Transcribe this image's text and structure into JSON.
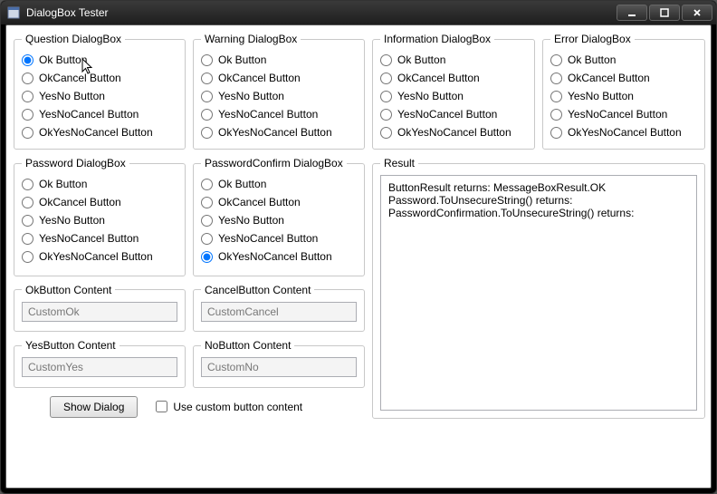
{
  "window": {
    "title": "DialogBox Tester"
  },
  "radio_options": [
    "Ok Button",
    "OkCancel Button",
    "YesNo Button",
    "YesNoCancel Button",
    "OkYesNoCancel Button"
  ],
  "groups": {
    "question": {
      "legend": "Question DialogBox",
      "selected": 0
    },
    "warning": {
      "legend": "Warning DialogBox",
      "selected": -1
    },
    "info": {
      "legend": "Information DialogBox",
      "selected": -1
    },
    "error": {
      "legend": "Error DialogBox",
      "selected": -1
    },
    "password": {
      "legend": "Password DialogBox",
      "selected": -1
    },
    "pwconfirm": {
      "legend": "PasswordConfirm DialogBox",
      "selected": 4
    }
  },
  "content_groups": {
    "ok": {
      "legend": "OkButton Content",
      "value": "CustomOk"
    },
    "cancel": {
      "legend": "CancelButton Content",
      "value": "CustomCancel"
    },
    "yes": {
      "legend": "YesButton Content",
      "value": "CustomYes"
    },
    "no": {
      "legend": "NoButton Content",
      "value": "CustomNo"
    }
  },
  "actions": {
    "show_dialog": "Show Dialog",
    "use_custom_label": "Use custom button content",
    "use_custom_checked": false
  },
  "result": {
    "legend": "Result",
    "text": "ButtonResult returns: MessageBoxResult.OK\nPassword.ToUnsecureString() returns:\nPasswordConfirmation.ToUnsecureString() returns:"
  }
}
